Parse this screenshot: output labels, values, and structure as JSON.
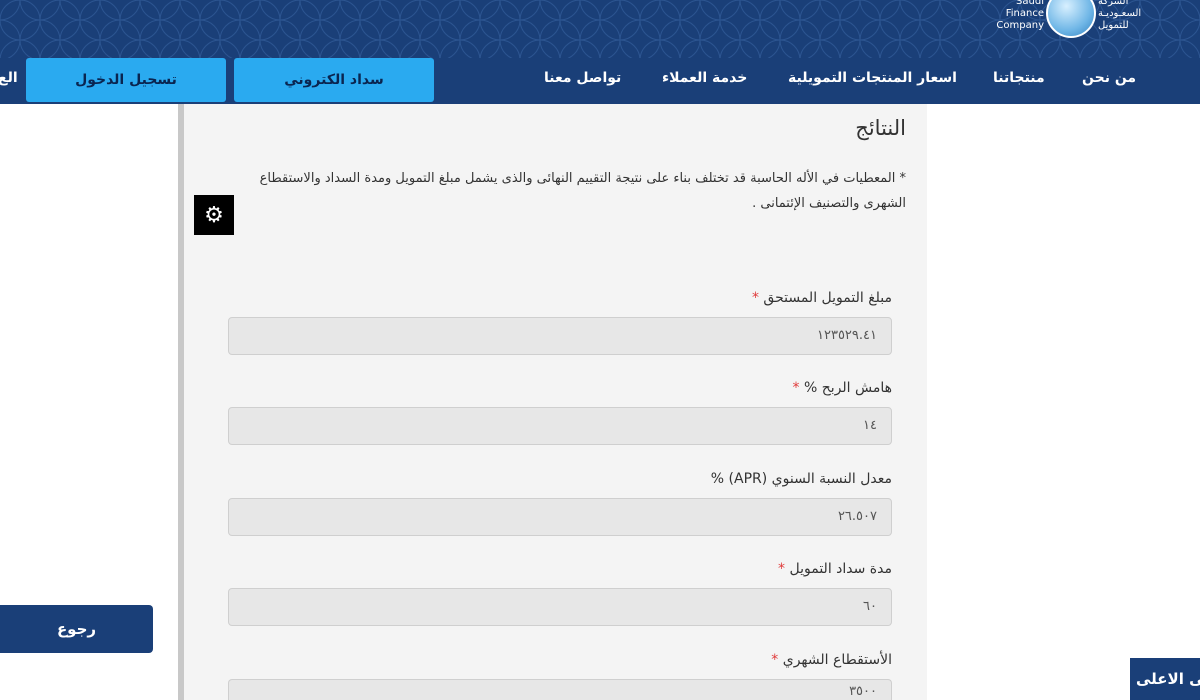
{
  "colors": {
    "header": "#1a3f78",
    "accent": "#2aaaf0",
    "required": "#e03a3a",
    "panel": "#f4f4f4"
  },
  "logo": {
    "en_lines": [
      "Saudi",
      "Finance",
      "Company"
    ],
    "ar_lines": [
      "الشركة",
      "السعـوديـة",
      "للتمويل"
    ]
  },
  "nav": {
    "about": "من نحن",
    "products": "منتجاتنا",
    "prices": "اسعار المنتجات التمويلية",
    "service": "خدمة العملاء",
    "contact": "تواصل معنا",
    "epay": "سداد الكتروني",
    "login": "تسجيل الدخول",
    "cut_item": "الع"
  },
  "results": {
    "title": "النتائج",
    "disclaimer": "* المعطيات في الأله الحاسبة قد تختلف بناء على نتيجة التقييم النهائى والذى يشمل مبلغ التمويل ومدة السداد والاستقطاع الشهرى والتصنيف الإئتمانى ."
  },
  "fields": [
    {
      "label": "مبلغ التمويل المستحق",
      "required": "*",
      "value": "١٢٣٥٢٩.٤١"
    },
    {
      "label": "هامش الربح %",
      "required": "*",
      "value": "١٤"
    },
    {
      "label": "معدل النسبة السنوي (APR) %",
      "required": "",
      "value": "٢٦.٥٠٧"
    },
    {
      "label": "مدة سداد التمويل",
      "required": "*",
      "value": "٦٠"
    },
    {
      "label": "الأستقطاع الشهري",
      "required": "*",
      "value": "٣٥٠٠"
    }
  ],
  "buttons": {
    "back": "رجوع",
    "to_top": "الى الاعلى"
  },
  "icons": {
    "settings": "gear-icon",
    "logo": "globe-logo-icon"
  }
}
